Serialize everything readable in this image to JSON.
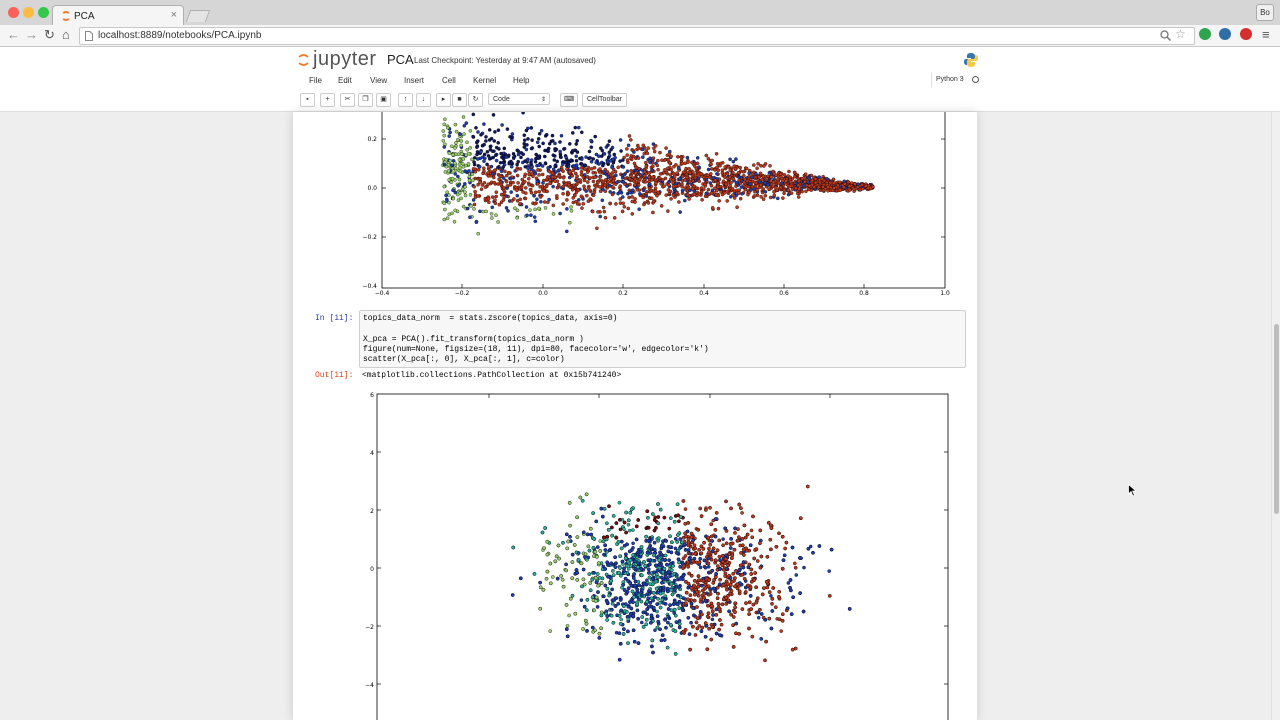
{
  "browser": {
    "tab_title": "PCA",
    "tab_close": "×",
    "profile": "Bo",
    "url": "localhost:8889/notebooks/PCA.ipynb",
    "traffic_lights": [
      "#fc605b",
      "#fdbc40",
      "#34c84a"
    ]
  },
  "jupyter": {
    "logo": "jupyter",
    "notebook_name": "PCA",
    "checkpoint": "Last Checkpoint: Yesterday at 9:47 AM (autosaved)",
    "menu": [
      "File",
      "Edit",
      "View",
      "Insert",
      "Cell",
      "Kernel",
      "Help"
    ],
    "kernel_name": "Python 3",
    "toolbar": {
      "icons": [
        "save-icon",
        "add-cell-icon",
        "cut-icon",
        "copy-icon",
        "paste-icon",
        "move-up-icon",
        "move-down-icon",
        "run-next-icon",
        "stop-icon",
        "restart-icon"
      ],
      "cell_type": "Code",
      "keyboard_icon": "keyboard-icon",
      "celltoolbar_label": "CellToolbar"
    }
  },
  "cell": {
    "in_prompt": "In [11]:",
    "out_prompt": "Out[11]:",
    "output_text": "<matplotlib.collections.PathCollection at 0x15b741240>",
    "code_lines": [
      "topics_data_norm  = stats.zscore(topics_data, axis=0)",
      "",
      "X_pca = PCA().fit_transform(topics_data_norm )",
      "figure(num=None, figsize=(18, 11), dpi=80, facecolor='w', edgecolor='k')",
      "scatter(X_pca[:, 0], X_pca[:, 1], c=color)"
    ]
  },
  "plot1": {
    "yticks": [
      "0.2",
      "0.0",
      "−0.2",
      "−0.4"
    ],
    "xticks": [
      "−0.4",
      "−0.2",
      "0.0",
      "0.2",
      "0.4",
      "0.6",
      "0.8",
      "1.0"
    ]
  },
  "plot2": {
    "yticks": [
      "6",
      "4",
      "2",
      "0",
      "−2",
      "−4"
    ]
  },
  "colors": {
    "jupyter_orange": "#f37726",
    "in_prompt": "#303f9f",
    "out_prompt": "#d84315",
    "cluster_red": "#c0391b",
    "cluster_navy": "#101a5c",
    "cluster_blue": "#1f3fb5",
    "cluster_green": "#9ad46a",
    "cluster_teal": "#2bb5a0",
    "cluster_darkred": "#7a0f0f"
  }
}
